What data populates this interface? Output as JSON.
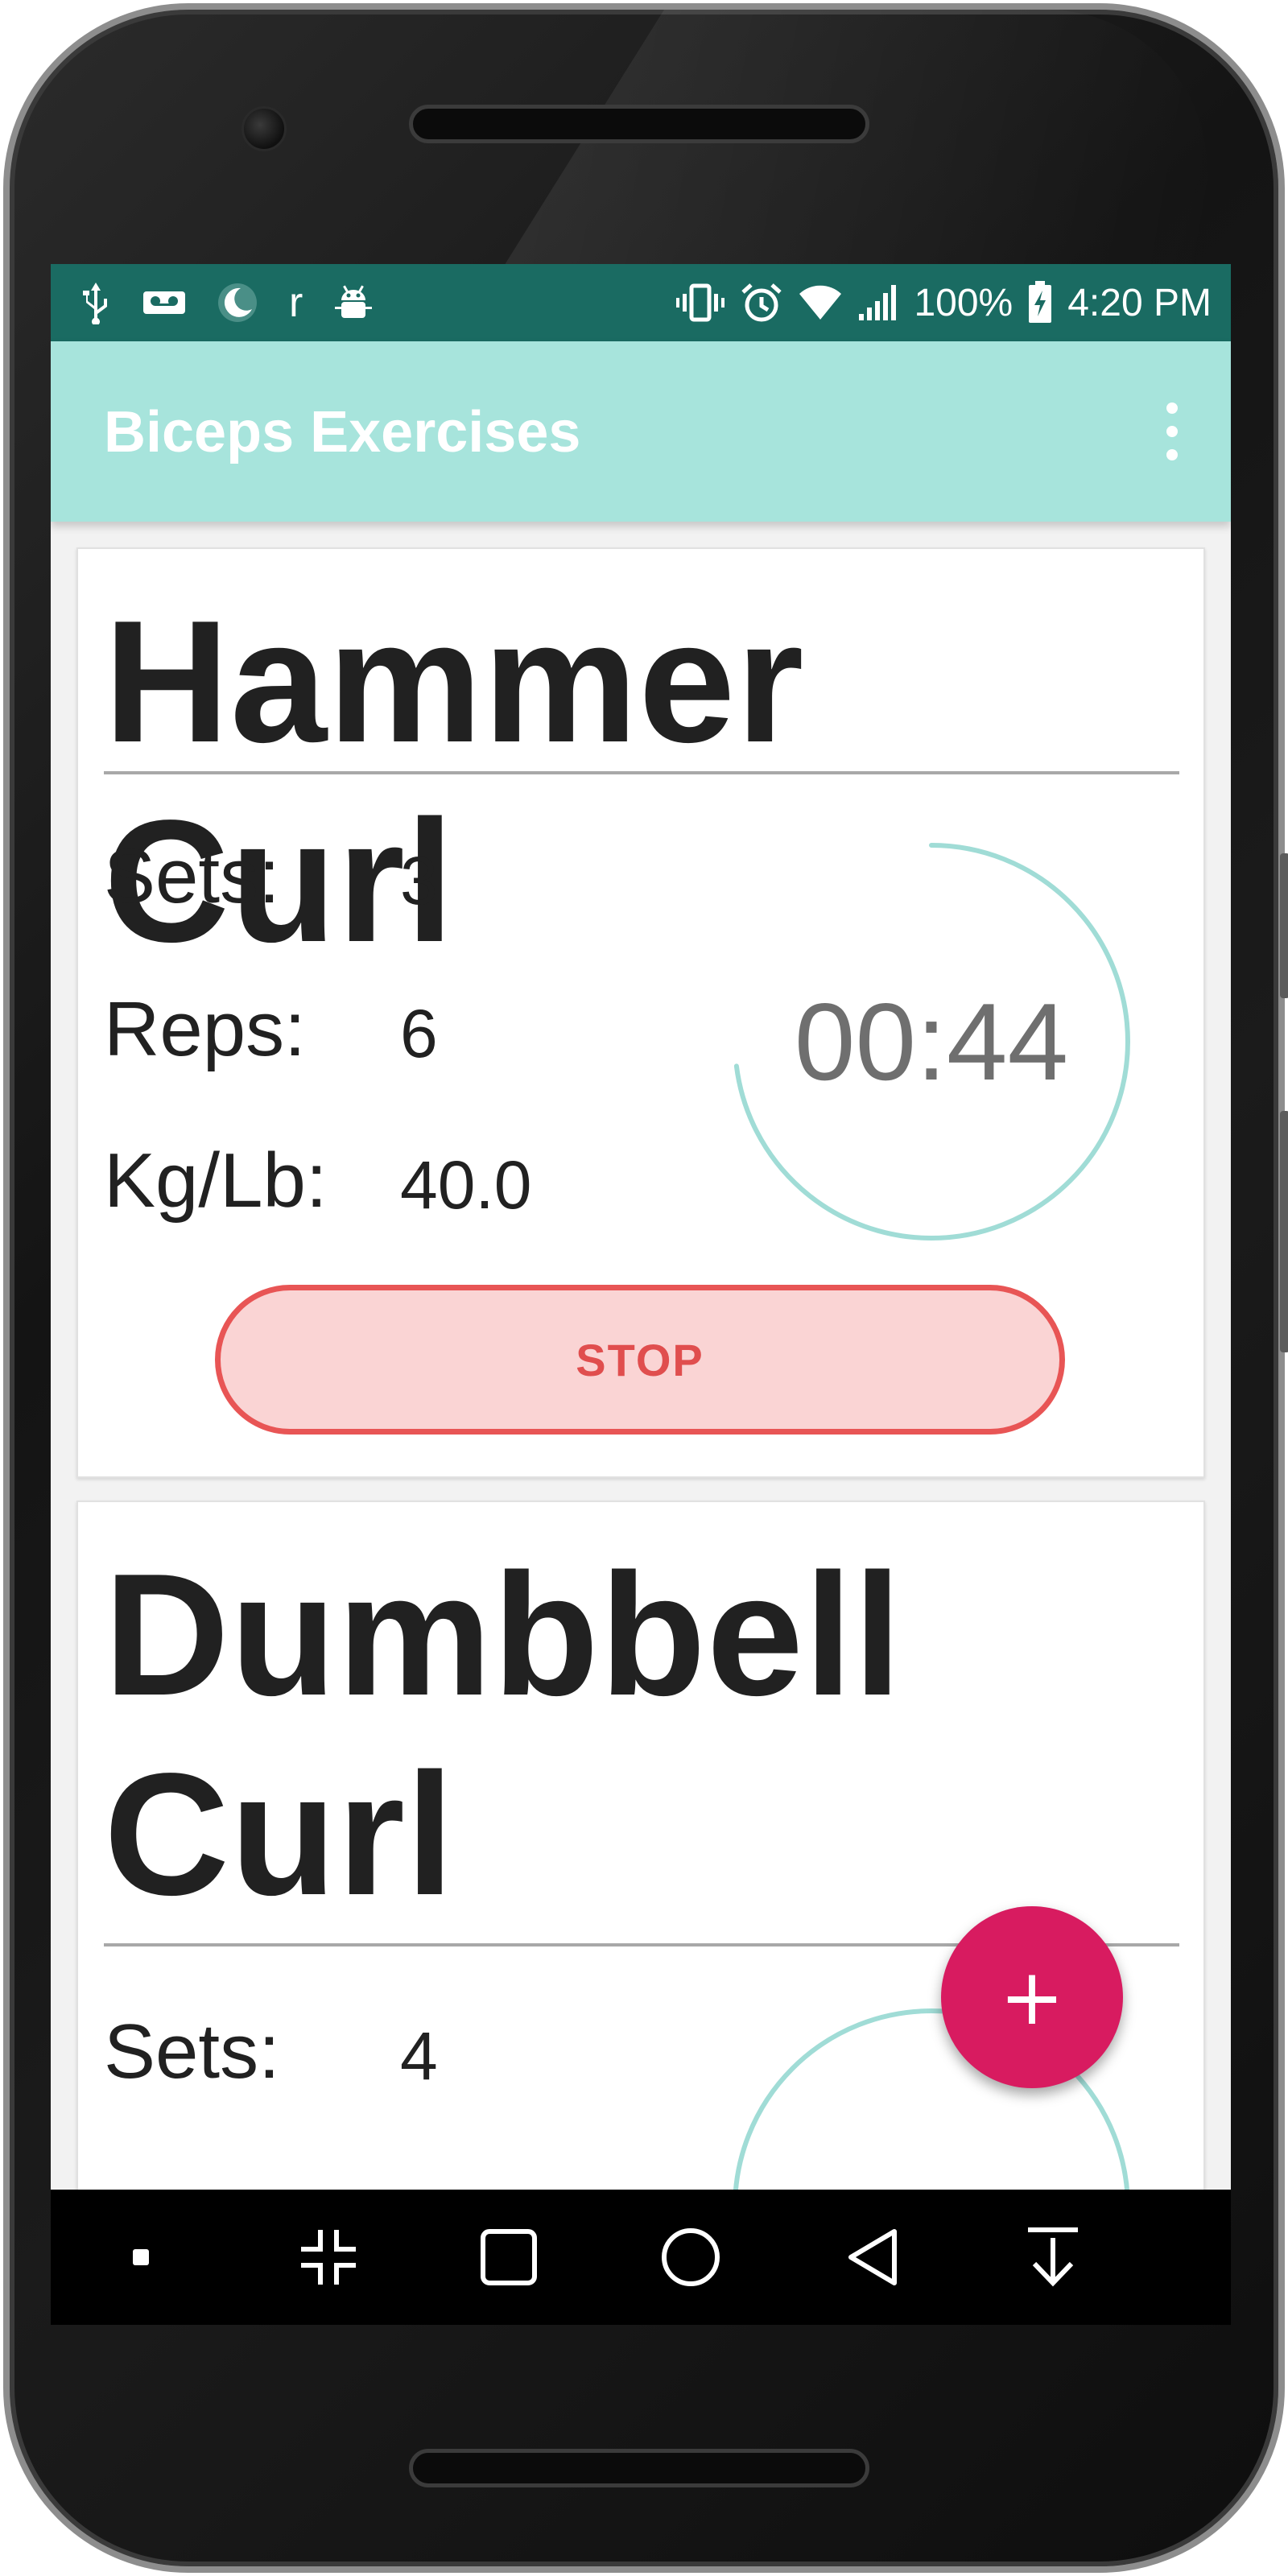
{
  "status_bar": {
    "battery": "100%",
    "time": "4:20 PM",
    "left_icons": [
      "usb-icon",
      "voicemail-icon",
      "moon-icon",
      "r-text-icon",
      "android-debug-icon"
    ],
    "right_icons": [
      "vibrate-icon",
      "alarm-icon",
      "wifi-icon",
      "signal-icon",
      "battery-charging-icon"
    ],
    "r_glyph": "r"
  },
  "app_bar": {
    "title": "Biceps Exercises",
    "menu_icon": "overflow-menu-icon"
  },
  "exercises": [
    {
      "name": "Hammer Curl",
      "sets_label": "Sets:",
      "sets": "3",
      "reps_label": "Reps:",
      "reps": "6",
      "weight_label": "Kg/Lb:",
      "weight": "40.0",
      "timer": "00:44",
      "timer_progress": 0.73,
      "action_label": "STOP"
    },
    {
      "name": "Dumbbell Curl",
      "name_line1": "Dumbbell",
      "name_line2": "Curl",
      "sets_label": "Sets:",
      "sets": "4"
    }
  ],
  "fab": {
    "label": "+",
    "icon": "add-icon"
  },
  "colors": {
    "status_bar": "#1a6b62",
    "app_bar": "#a7e4dc",
    "timer_ring": "#a0dcd6",
    "stop_fill": "#fad4d4",
    "stop_border": "#e85555",
    "fab": "#d81b60"
  },
  "nav_bar": {
    "items": [
      "screenshot-dot-icon",
      "collapse-icon",
      "recents-icon",
      "home-icon",
      "back-icon",
      "download-arrow-icon"
    ]
  }
}
